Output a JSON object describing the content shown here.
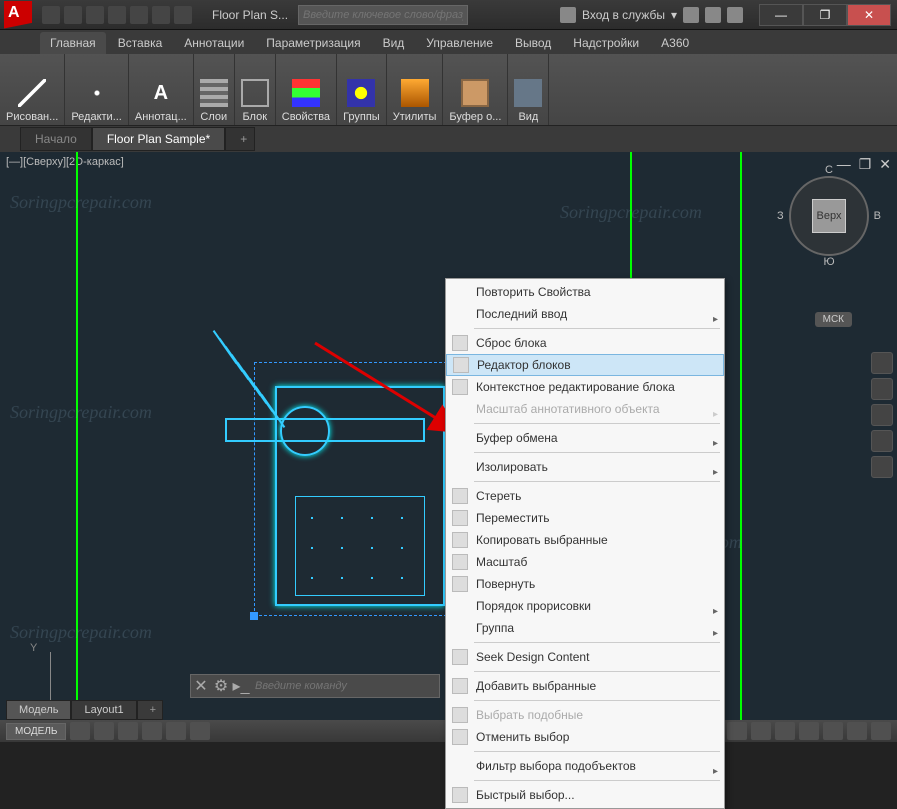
{
  "window": {
    "title": "Floor Plan S...",
    "minimize": "—",
    "maximize": "❐",
    "close": "✕"
  },
  "search": {
    "placeholder": "Введите ключевое слово/фразу"
  },
  "signin": "Вход в службы",
  "maintabs": [
    "Главная",
    "Вставка",
    "Аннотации",
    "Параметризация",
    "Вид",
    "Управление",
    "Вывод",
    "Надстройки",
    "A360"
  ],
  "ribbon": [
    {
      "label": "Рисован..."
    },
    {
      "label": "Редакти..."
    },
    {
      "label": "Аннотац..."
    },
    {
      "label": "Слои"
    },
    {
      "label": "Блок"
    },
    {
      "label": "Свойства"
    },
    {
      "label": "Группы"
    },
    {
      "label": "Утилиты"
    },
    {
      "label": "Буфер о..."
    },
    {
      "label": "Вид"
    }
  ],
  "doctabs": {
    "start": "Начало",
    "active": "Floor Plan Sample*"
  },
  "viewport": {
    "label": "[—][Сверху][2D-каркас]"
  },
  "viewcube": {
    "top": "Верх",
    "n": "С",
    "s": "Ю",
    "e": "В",
    "w": "З",
    "wcs": "МСК"
  },
  "command": {
    "placeholder": "Введите команду"
  },
  "layouts": {
    "model": "Модель",
    "layout1": "Layout1"
  },
  "status": {
    "model": "МОДЕЛЬ"
  },
  "context": {
    "repeat": "Повторить Свойства",
    "recent": "Последний ввод",
    "reset": "Сброс блока",
    "editor": "Редактор блоков",
    "inplace": "Контекстное редактирование блока",
    "annoscale": "Масштаб аннотативного объекта",
    "clipboard": "Буфер обмена",
    "isolate": "Изолировать",
    "erase": "Стереть",
    "move": "Переместить",
    "copy": "Копировать выбранные",
    "scale": "Масштаб",
    "rotate": "Повернуть",
    "draworder": "Порядок прорисовки",
    "group": "Группа",
    "seek": "Seek Design Content",
    "addsel": "Добавить выбранные",
    "selsim": "Выбрать подобные",
    "desel": "Отменить выбор",
    "subfilter": "Фильтр выбора подобъектов",
    "qsel": "Быстрый выбор..."
  },
  "watermark": "Soringpcrepair.com"
}
